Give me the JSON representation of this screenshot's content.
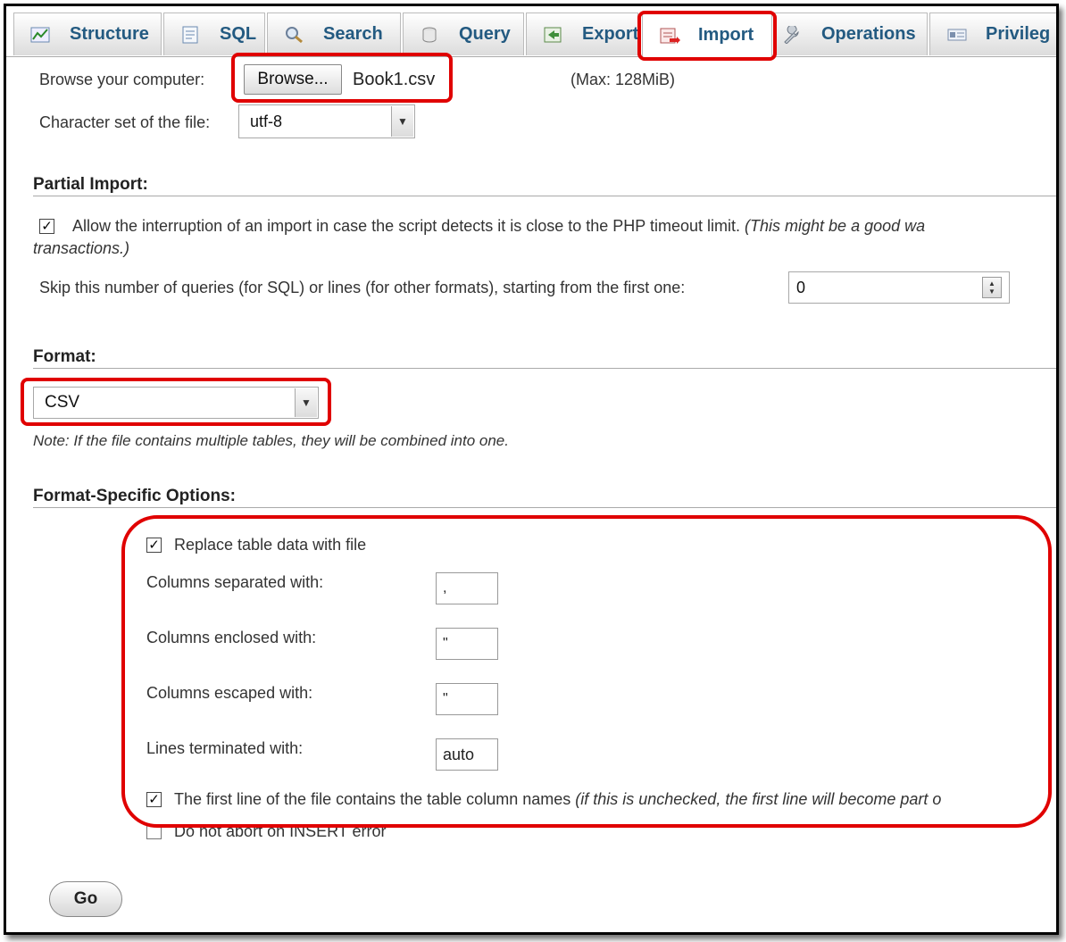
{
  "tabs": [
    {
      "label": "Structure",
      "icon": "structure-icon"
    },
    {
      "label": "SQL",
      "icon": "sql-icon"
    },
    {
      "label": "Search",
      "icon": "search-icon"
    },
    {
      "label": "Query",
      "icon": "query-icon"
    },
    {
      "label": "Export",
      "icon": "export-icon"
    },
    {
      "label": "Import",
      "icon": "import-icon",
      "active": true
    },
    {
      "label": "Operations",
      "icon": "wrench-icon"
    },
    {
      "label": "Privileg",
      "icon": "privileges-icon"
    }
  ],
  "file": {
    "browse_label": "Browse your computer:",
    "browse_button": "Browse...",
    "filename": "Book1.csv",
    "max_size": "(Max: 128MiB)",
    "charset_label": "Character set of the file:",
    "charset_value": "utf-8"
  },
  "partial": {
    "title": "Partial Import:",
    "allow_text": "Allow the interruption of an import in case the script detects it is close to the PHP timeout limit.",
    "allow_note": "(This might be a good wa",
    "allow_note_2": "transactions.)",
    "allow_checked": true,
    "skip_label": "Skip this number of queries (for SQL) or lines (for other formats), starting from the first one:",
    "skip_value": "0"
  },
  "format": {
    "title": "Format:",
    "value": "CSV",
    "note": "Note: If the file contains multiple tables, they will be combined into one."
  },
  "options": {
    "title": "Format-Specific Options:",
    "replace_label": "Replace table data with file",
    "replace_checked": true,
    "separated_label": "Columns separated with:",
    "separated_value": ",",
    "enclosed_label": "Columns enclosed with:",
    "enclosed_value": "\"",
    "escaped_label": "Columns escaped with:",
    "escaped_value": "\"",
    "lines_label": "Lines terminated with:",
    "lines_value": "auto",
    "firstline_label": "The first line of the file contains the table column names",
    "firstline_note": "(if this is unchecked, the first line will become part o",
    "firstline_checked": true,
    "noabort_label": "Do not abort on INSERT error",
    "noabort_checked": false
  },
  "go_label": "Go",
  "highlight_color": "#e00000",
  "tab_text_color": "#235a81"
}
